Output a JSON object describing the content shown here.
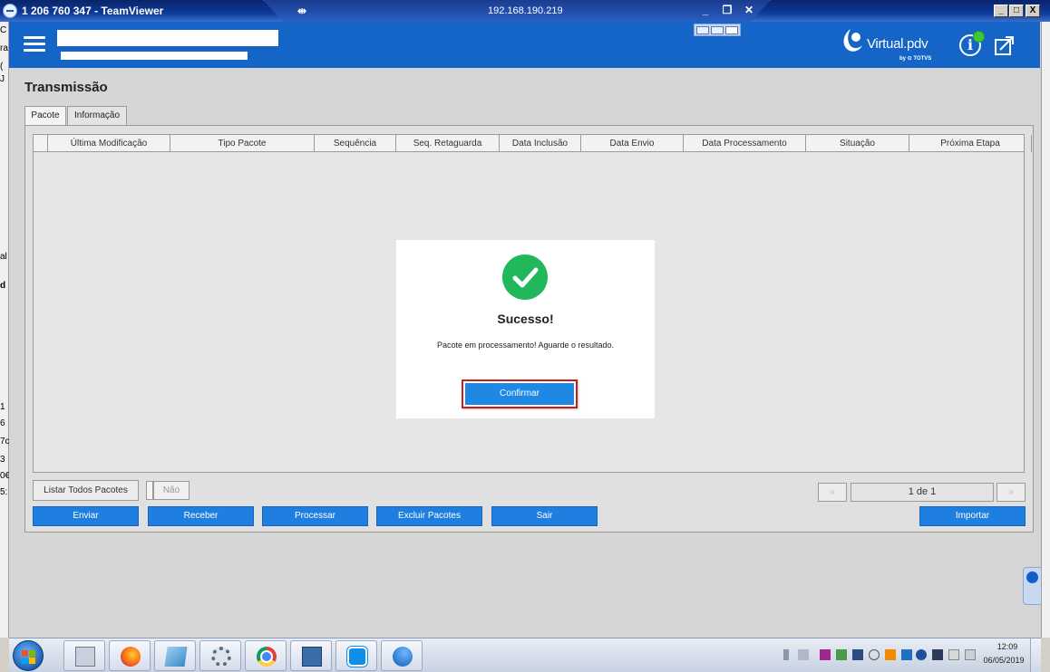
{
  "window": {
    "title": "1 206 760 347 - TeamViewer",
    "remote_address": "192.168.190.219",
    "pin_glyph": "⇹",
    "min_glyph": "_",
    "restore_glyph": "❐",
    "close_glyph": "✕",
    "win_min": "_",
    "win_max": "□",
    "win_close": "X"
  },
  "left_strip": [
    "C",
    "ra",
    "(",
    "J",
    "al",
    "d",
    "1",
    "6",
    "7c",
    "3",
    "0€",
    "5:"
  ],
  "app": {
    "logo_text": "Virtual.pdv",
    "logo_sub": "by ⊙ TOTVS",
    "info_glyph": "i"
  },
  "page": {
    "title": "Transmissão",
    "tabs": [
      "Pacote",
      "Informação"
    ]
  },
  "grid": {
    "columns": [
      "Última Modificação",
      "Tipo Pacote",
      "Sequência",
      "Seq. Retaguarda",
      "Data Inclusão",
      "Data Envio",
      "Data Processamento",
      "Situação",
      "Próxima Etapa"
    ],
    "rows": []
  },
  "controls": {
    "list_all": "Listar Todos Pacotes",
    "toggle_value": "Não",
    "prev": "«",
    "next": "»",
    "page_indicator": "1 de 1"
  },
  "actions": [
    "Enviar",
    "Receber",
    "Processar",
    "Excluir Pacotes",
    "Sair"
  ],
  "import_label": "Importar",
  "dialog": {
    "title": "Sucesso!",
    "message": "Pacote em processamento! Aguarde o resultado.",
    "confirm": "Confirmar"
  },
  "taskbar": {
    "time": "12:09",
    "date": "06/05/2019",
    "items": [
      "calculator-icon",
      "firefox-icon",
      "notepad-icon",
      "settings-gears-icon",
      "chrome-icon",
      "network-console-icon",
      "teamviewer-icon",
      "virtualpdv-icon"
    ]
  },
  "colors": {
    "header": "#1565c8",
    "primary_button": "#1e7fe0",
    "success": "#20b85a",
    "highlight_outline": "#c02020"
  }
}
